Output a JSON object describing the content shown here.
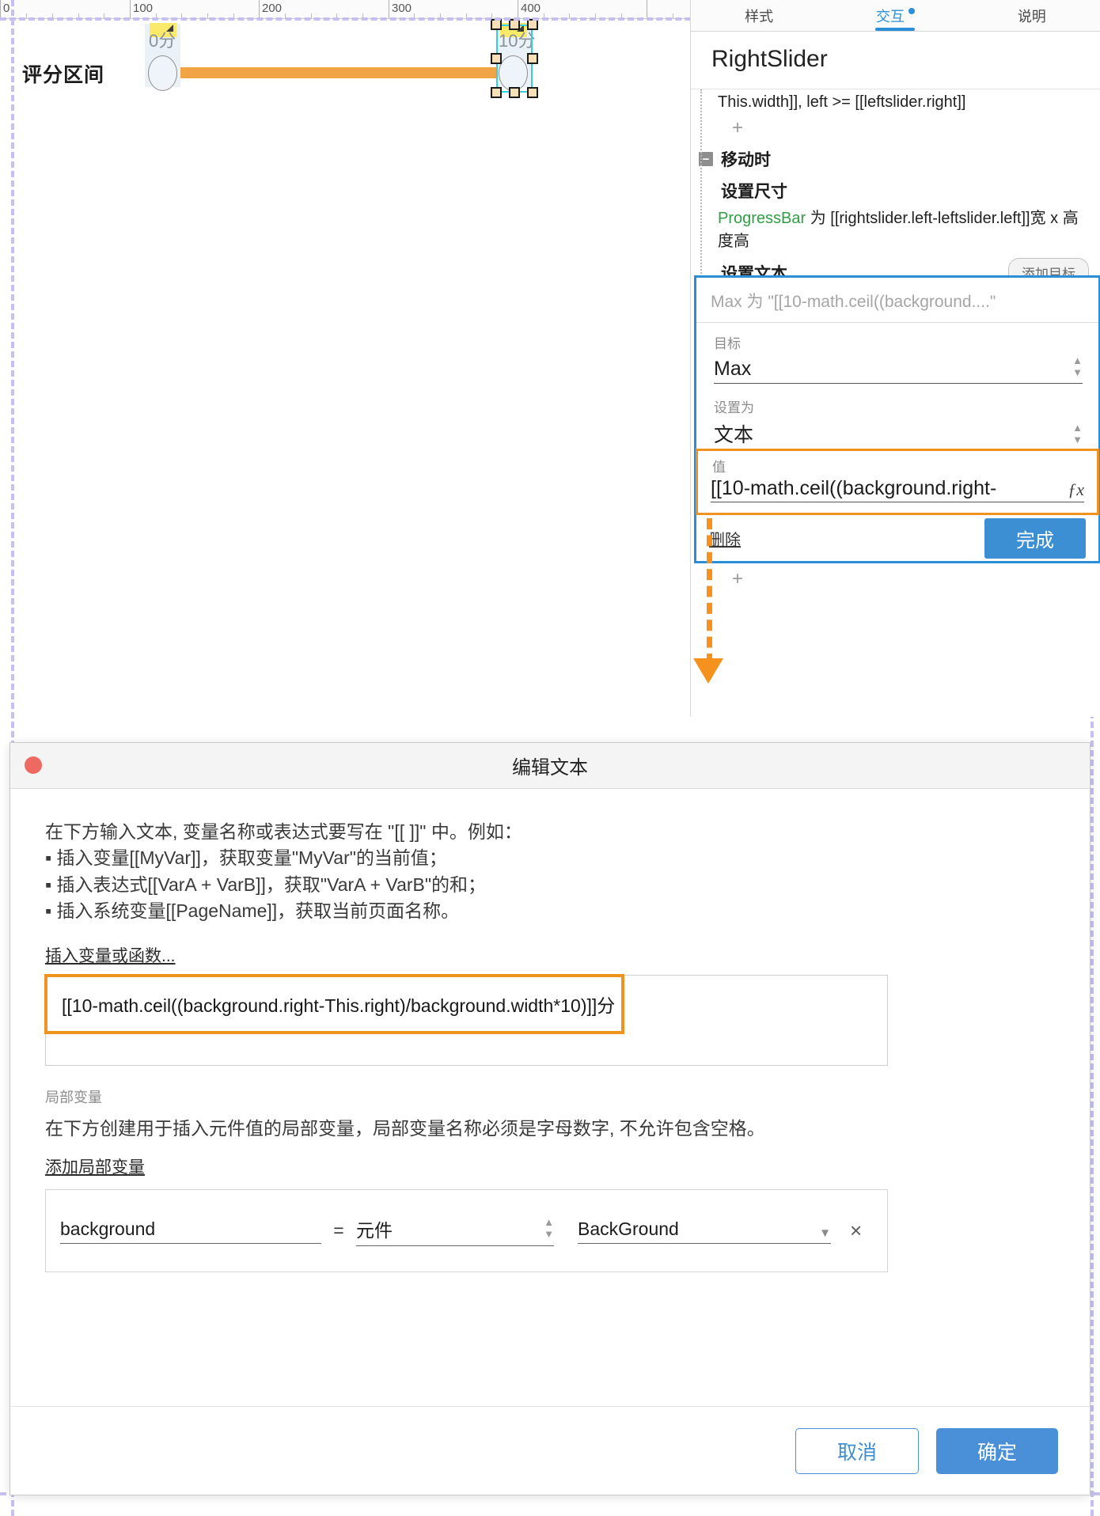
{
  "canvas": {
    "ruler_labels": [
      "0",
      "100",
      "200",
      "300",
      "400"
    ],
    "group_label": "评分区间",
    "left_slider_caption": "0分",
    "right_slider_caption": "10分"
  },
  "inspector": {
    "tabs": [
      {
        "label": "样式",
        "active": false,
        "dot": false
      },
      {
        "label": "交互",
        "active": true,
        "dot": true
      },
      {
        "label": "说明",
        "active": false,
        "dot": false
      }
    ],
    "title": "RightSlider",
    "condition_tail": "This.width]], left >= [[leftslider.right]]",
    "plus": "+",
    "event_group": "移动时",
    "action_set_size": "设置尺寸",
    "set_size_target": "ProgressBar",
    "set_size_rest": "为 [[rightslider.left-leftslider.left]]宽 x 高度高",
    "action_set_text": "设置文本",
    "add_target_button": "添加目标",
    "ghost_summary": "Max 为 \"[[10-math.ceil((background....\"",
    "target_label": "目标",
    "target_value": "Max",
    "set_as_label": "设置为",
    "set_as_value": "文本",
    "value_label": "值",
    "value_text": "[[10-math.ceil((background.right-",
    "fx_icon": "ƒx",
    "delete_link": "删除",
    "done_button": "完成",
    "plus_bottom": "+"
  },
  "dialog": {
    "title": "编辑文本",
    "instruction_head": "在下方输入文本, 变量名称或表达式要写在 \"[[ ]]\" 中。例如：",
    "instruction_bullets": [
      "插入变量[[MyVar]]，获取变量\"MyVar\"的当前值；",
      "插入表达式[[VarA + VarB]]，获取\"VarA + VarB\"的和；",
      "插入系统变量[[PageName]]，获取当前页面名称。"
    ],
    "insert_link": "插入变量或函数...",
    "expression": "[[10-math.ceil((background.right-This.right)/background.width*10)]]分",
    "local_var_label": "局部变量",
    "local_var_desc": "在下方创建用于插入元件值的局部变量，局部变量名称必须是字母数字, 不允许包含空格。",
    "add_local_var_link": "添加局部变量",
    "var_row": {
      "name": "background",
      "equals": "=",
      "type": "元件",
      "value": "BackGround",
      "remove_icon": "×"
    },
    "cancel_button": "取消",
    "ok_button": "确定"
  },
  "colors": {
    "accent_blue": "#2a8fd8",
    "highlight_orange": "#ef9220",
    "track_orange": "#f0a446",
    "selection_cyan": "#33cee0",
    "page_boundary_purple": "#c5c0ef"
  }
}
